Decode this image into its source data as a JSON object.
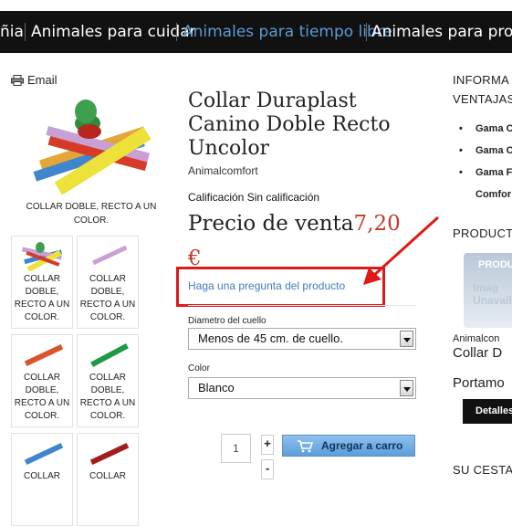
{
  "nav": {
    "items": [
      "ñia",
      "Animales para cuidar",
      "Animales para tiempo libre",
      "Animales para produ"
    ],
    "active_index": 2
  },
  "email_label": "Email",
  "product": {
    "main_caption": "COLLAR DOBLE, RECTO A UN COLOR.",
    "thumb_captions": [
      "COLLAR DOBLE, RECTO A UN COLOR.",
      "COLLAR DOBLE, RECTO A UN COLOR.",
      "COLLAR DOBLE, RECTO A UN COLOR.",
      "COLLAR DOBLE, RECTO A UN COLOR.",
      "COLLAR",
      "COLLAR"
    ],
    "title": "Collar Duraplast Canino Doble Recto Uncolor",
    "brand": "Animalcomfort",
    "rating_label": "Calificación",
    "rating_value": "Sin calificación",
    "price_label": "Precio de venta",
    "price_amount": "7,20",
    "price_currency": "€",
    "ask_link": "Haga una pregunta del producto",
    "neck_label": "Diametro del cuello",
    "neck_value": "Menos de 45 cm. de cuello.",
    "color_label": "Color",
    "color_value": "Blanco",
    "quantity": "1",
    "plus_label": "+",
    "minus_label": "-",
    "add_to_cart": "Agregar a carro"
  },
  "sidebar": {
    "info_heading_1": "INFORMA",
    "info_heading_2": "VENTAJAS",
    "list": [
      "Gama C",
      "Gama C",
      "Gama F",
      "Comfor"
    ],
    "products_heading": "PRODUCT",
    "placeholder_top": "PRODU",
    "placeholder_bottom_1": "Imag",
    "placeholder_bottom_2": "Unavail",
    "prod_brand": "Animalcon",
    "prod_name": "Collar D",
    "prod_price": "Portamo",
    "details_button": "Detalles",
    "cart_heading": "SU CESTA"
  },
  "colors": {
    "nav_bg": "#111111",
    "nav_active": "#5b9bd5",
    "price": "#c0392b",
    "highlight": "#e01818",
    "link": "#3f7cc0"
  }
}
